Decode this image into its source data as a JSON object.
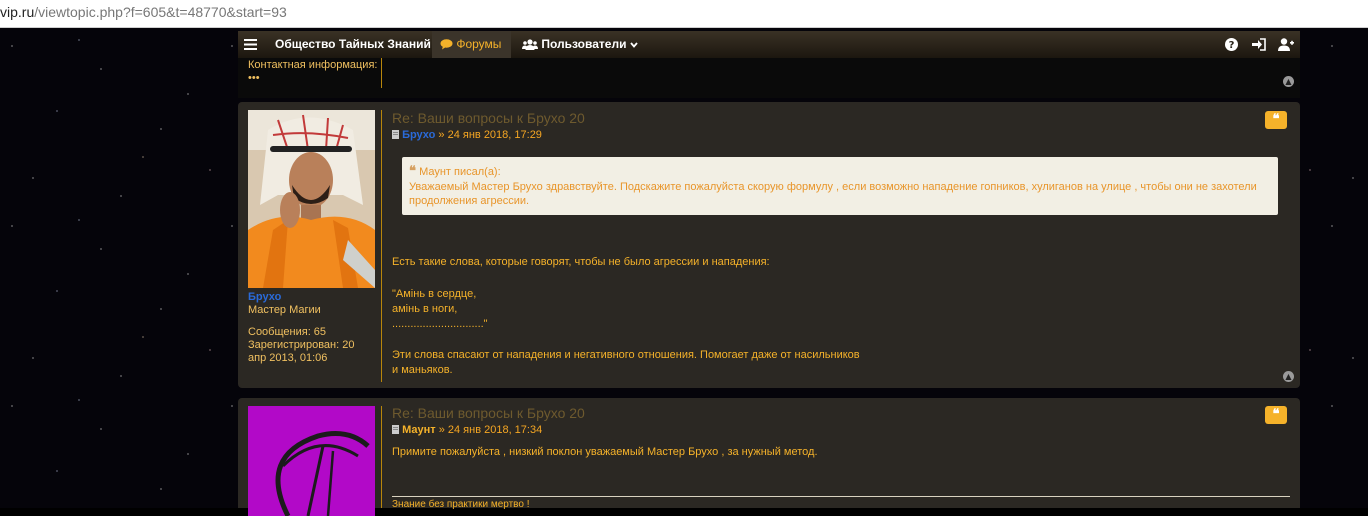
{
  "url": {
    "host": "vip.ru",
    "path": "/viewtopic.php?f=605&t=48770&start=93"
  },
  "navbar": {
    "menu_icon": "hamburger-icon",
    "site_title": "Общество Тайных Знаний",
    "forums_label": "Форумы",
    "users_label": "Пользователи",
    "right_icons": [
      "help-icon",
      "login-icon",
      "register-icon"
    ]
  },
  "prev_post": {
    "contact_label": "Контактная информация:",
    "contact_more": "•••"
  },
  "posts": [
    {
      "title": "Re: Ваши вопросы к Брухо 20",
      "author": "Брухо",
      "date": "» 24 янв 2018, 17:29",
      "profile": {
        "name": "Брухо",
        "rank": "Мастер Магии",
        "messages": "Сообщения: 65",
        "registered": "Зарегистрирован: 20 апр 2013, 01:06"
      },
      "quote": {
        "cite": "Маунт писал(а):",
        "text": "Уважаемый Мастер Брухо здравствуйте. Подскажите пожалуйста скорую формулу , если возможно нападение гопников, хулиганов на улице , чтобы они не захотели продолжения агрессии."
      },
      "body": [
        "Есть такие слова, которые говорят, чтобы не было агрессии и нападения:",
        "\"Амінь в сердце,",
        "амінь в ноги,",
        "..............................\"",
        "Эти слова спасают от нападения и негативного отношения. Помогает даже от насильников",
        "и маньяков."
      ]
    },
    {
      "title": "Re: Ваши вопросы к Брухо 20",
      "author": "Маунт",
      "date": "» 24 янв 2018, 17:34",
      "body": "Примите пожалуйста , низкий поклон уважаемый Мастер Брухо , за нужный метод.",
      "signature": "Знание без практики мертво !"
    }
  ],
  "colors": {
    "accent": "#f5b22a",
    "author_blue": "#2a6ad8",
    "post_bg": "#2b2823"
  }
}
